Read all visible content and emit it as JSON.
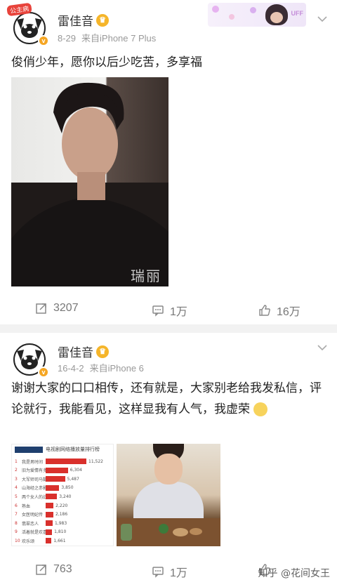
{
  "colors": {
    "accent": "#f5a623",
    "chart_bar": "#d9302c",
    "meta_text": "#999999",
    "background": "#f2f2f2"
  },
  "post1": {
    "avatar_tag": "公主病",
    "author": "雷佳音",
    "date": "8-29",
    "source": "来自iPhone 7 Plus",
    "text": "俊俏少年，愿你以后少吃苦，多享福",
    "photo_watermark": "瑞丽",
    "stats": {
      "reposts": "3207",
      "comments": "1万",
      "likes": "16万"
    }
  },
  "post2": {
    "author": "雷佳音",
    "date": "16-4-2",
    "source": "来自iPhone 6",
    "text": "谢谢大家的口口相传，还有就是，大家别老给我发私信，评论就行，我能看见，这样显我有人气，我虚荣",
    "chart_title": "电视剧网络播放量排行榜",
    "stats": {
      "reposts": "763",
      "comments": "1万",
      "likes": ""
    }
  },
  "watermark": "知乎 @花间女王",
  "chart_data": {
    "type": "bar",
    "title": "电视剧网络播放量排行榜",
    "categories": [
      "我是男时间",
      "旧为爱情有多糖",
      "大军师司马懿",
      "山海经之赤影传说",
      "两个女人的战争",
      "熟血",
      "女医明妃传",
      "翡翠恋人",
      "活着就是欢喜",
      "欢乐颂"
    ],
    "values": [
      11522,
      6304,
      5487,
      3850,
      3240,
      2220,
      2186,
      1983,
      1810,
      1661
    ]
  }
}
